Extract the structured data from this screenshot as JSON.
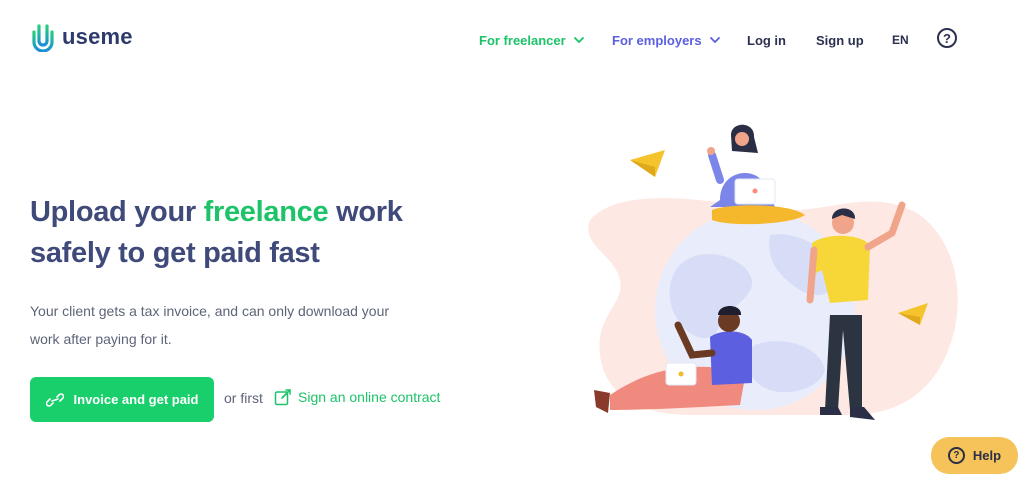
{
  "brand": {
    "name": "useme",
    "color_green": "#1dc368",
    "color_blue": "#5b5fe0",
    "color_navy": "#3f4a7a"
  },
  "nav": {
    "for_freelancer": "For freelancer",
    "for_employers": "For employers",
    "login": "Log in",
    "signup": "Sign up",
    "language": "EN",
    "help_icon": "question-circle-icon"
  },
  "hero": {
    "headline_part1": "Upload your ",
    "headline_highlight": "freelance",
    "headline_part2": " work",
    "headline_line2": "safely to get paid fast",
    "subtext_line1": "Your client gets a tax invoice, and can only download your",
    "subtext_line2": "work after paying for it.",
    "cta_label": "Invoice and get paid",
    "or_first": "or first",
    "contract_link": "Sign an online contract"
  },
  "help_widget": {
    "label": "Help",
    "icon": "question-circle-icon",
    "color": "#f5c35a"
  }
}
